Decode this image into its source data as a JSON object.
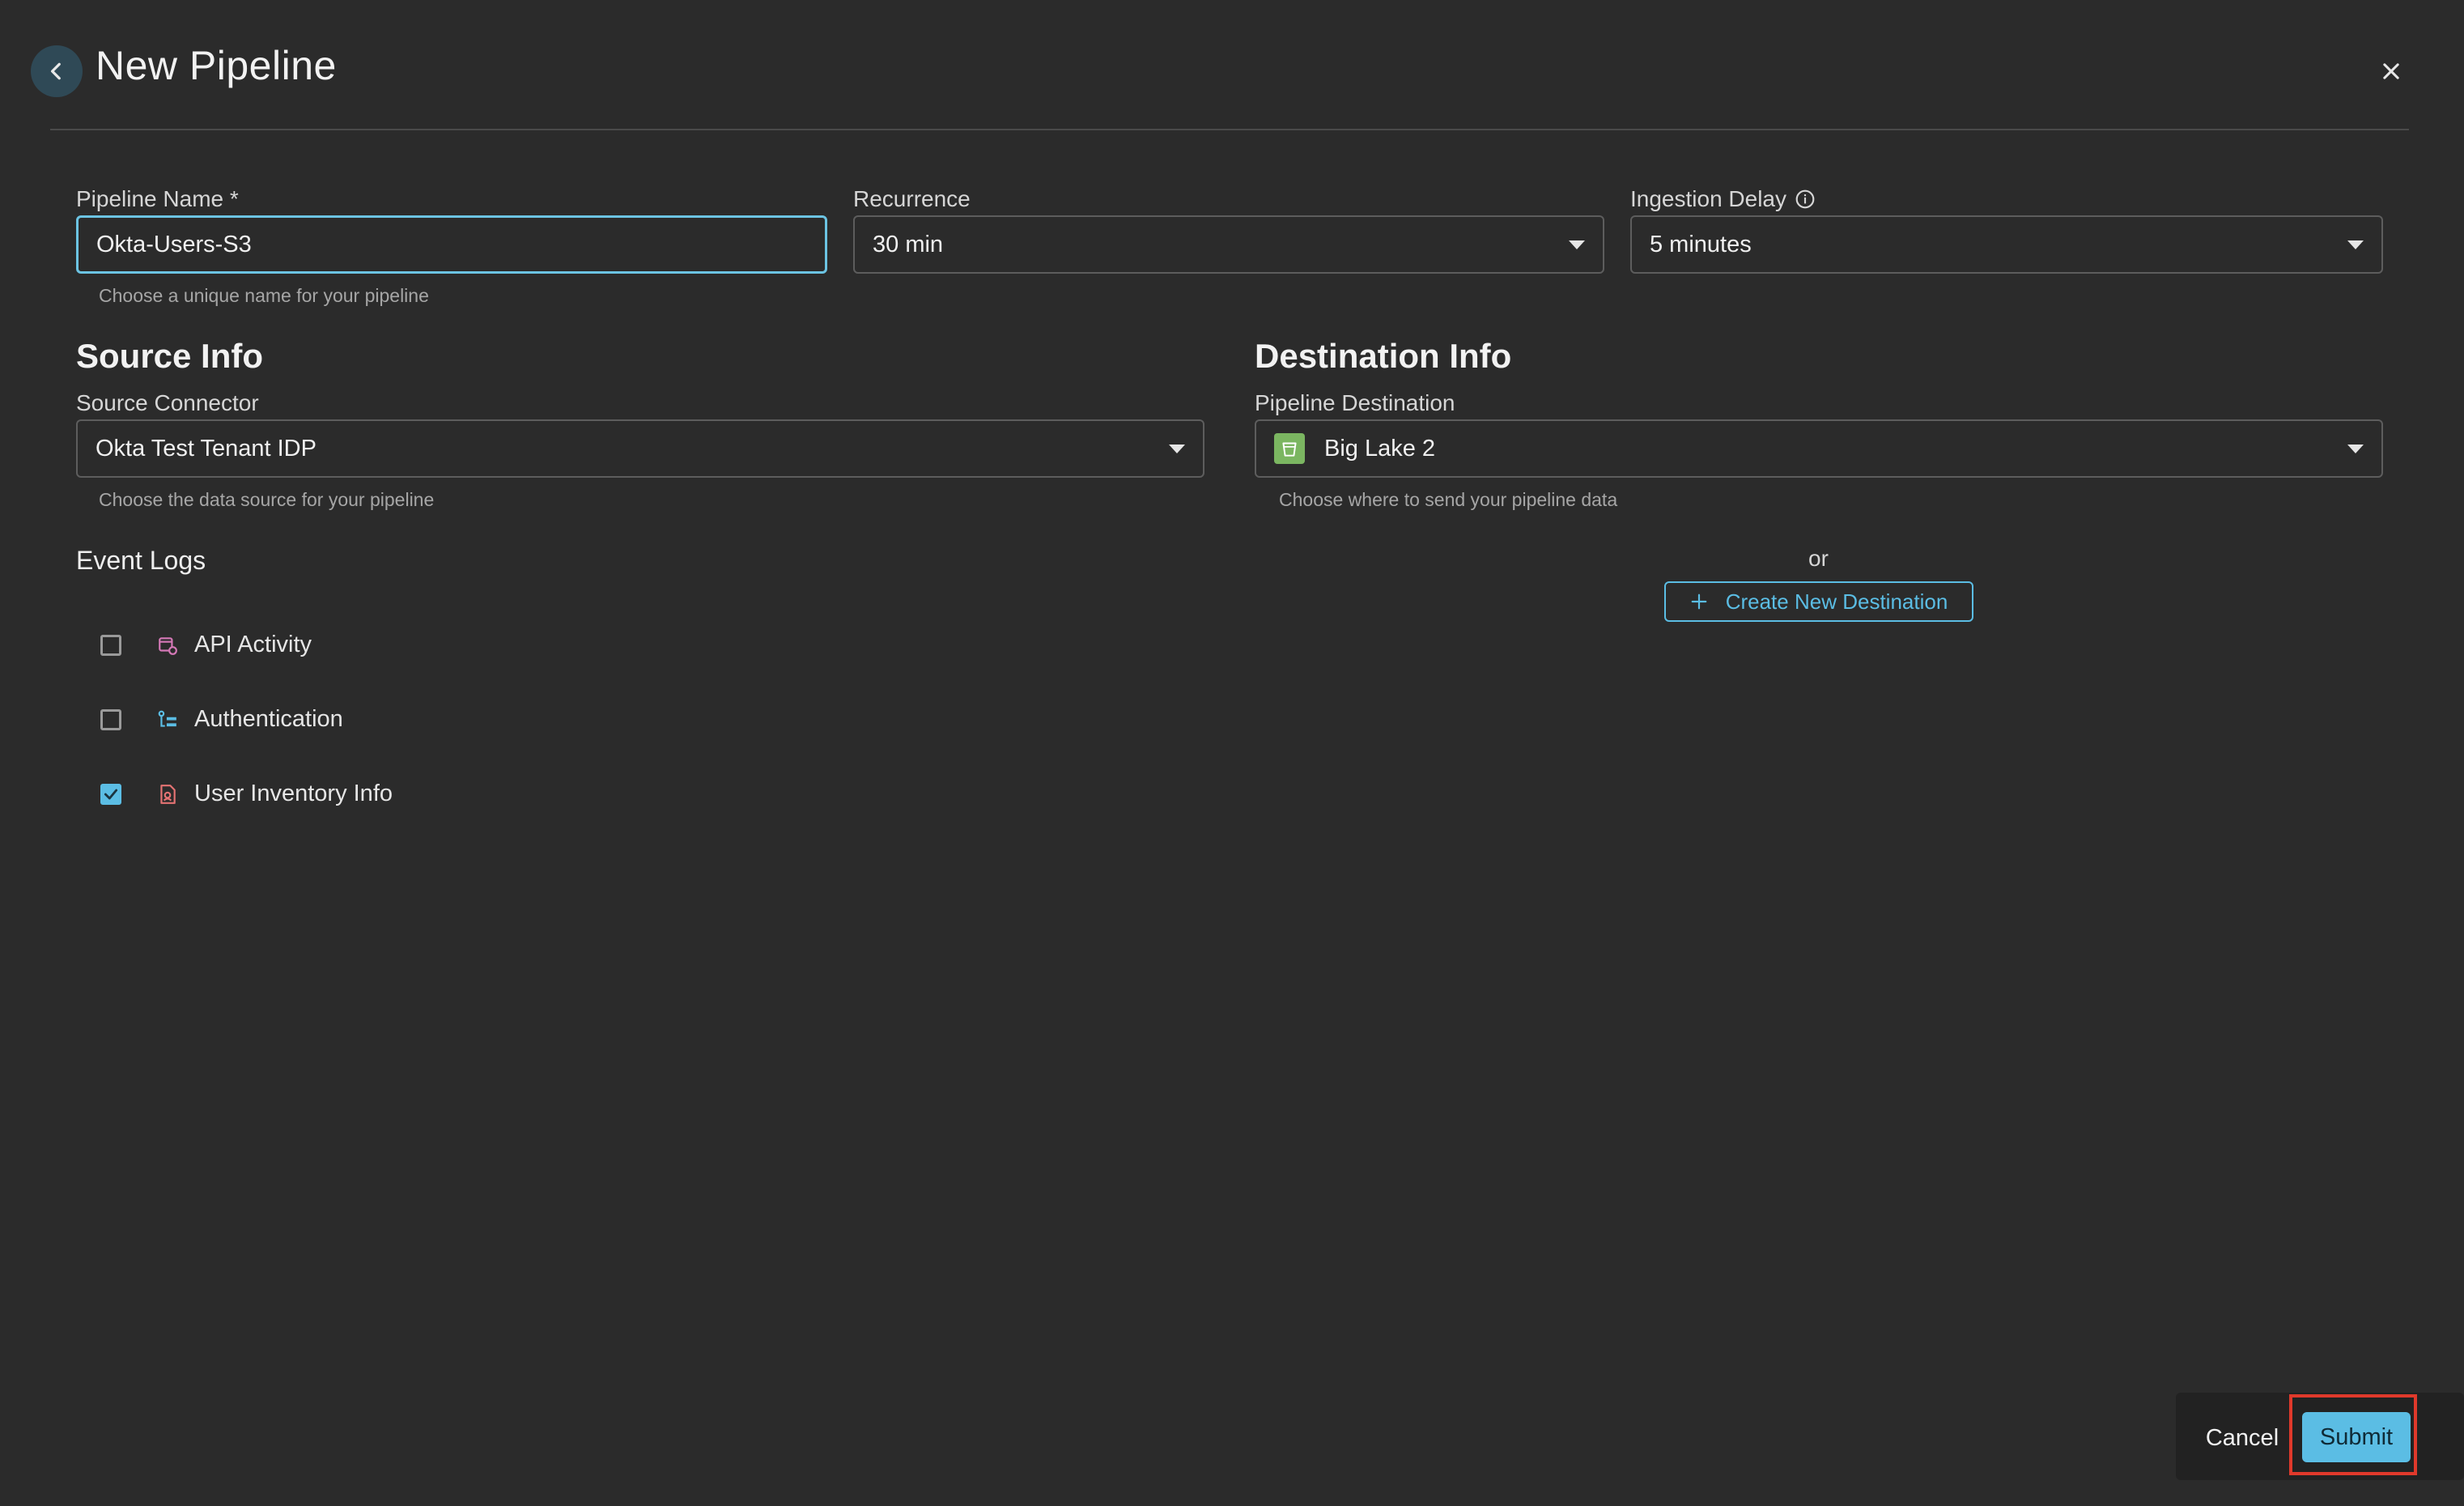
{
  "header": {
    "title": "New Pipeline"
  },
  "pipeline_name": {
    "label": "Pipeline Name *",
    "value": "Okta-Users-S3",
    "helper": "Choose a unique name for your pipeline"
  },
  "recurrence": {
    "label": "Recurrence",
    "value": "30 min"
  },
  "ingestion_delay": {
    "label": "Ingestion Delay",
    "value": "5 minutes"
  },
  "source": {
    "title": "Source Info",
    "connector_label": "Source Connector",
    "connector_value": "Okta Test Tenant IDP",
    "helper": "Choose the data source for your pipeline"
  },
  "destination": {
    "title": "Destination Info",
    "label": "Pipeline Destination",
    "value": "Big Lake 2",
    "helper": "Choose where to send your pipeline data",
    "or_text": "or",
    "create_label": "Create New Destination"
  },
  "event_logs": {
    "title": "Event Logs",
    "items": [
      {
        "label": "API Activity",
        "checked": false,
        "icon": "api-activity-icon"
      },
      {
        "label": "Authentication",
        "checked": false,
        "icon": "authentication-icon"
      },
      {
        "label": "User Inventory Info",
        "checked": true,
        "icon": "user-inventory-icon"
      }
    ]
  },
  "footer": {
    "cancel_label": "Cancel",
    "submit_label": "Submit"
  },
  "colors": {
    "accent": "#5bbde4",
    "background": "#2b2b2b",
    "highlight": "#e0392b"
  }
}
